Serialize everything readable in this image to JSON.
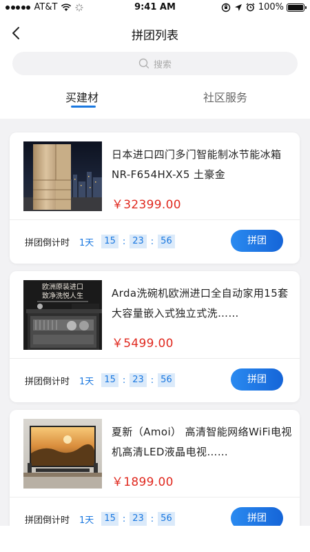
{
  "status_bar": {
    "carrier": "AT&T",
    "time": "9:41 AM",
    "battery": "100%"
  },
  "nav": {
    "title": "拼团列表"
  },
  "search": {
    "placeholder": "搜索"
  },
  "tabs": [
    {
      "label": "买建材",
      "active": true
    },
    {
      "label": "社区服务",
      "active": false
    }
  ],
  "products": [
    {
      "name": "日本进口四门多门智能制冰节能冰箱NR-F654HX-X5 土豪金",
      "price": "￥32399.00",
      "countdown_label": "拼团倒计时",
      "days": "1天",
      "hours": "15",
      "minutes": "23",
      "seconds": "56",
      "button": "拼团",
      "image_icon": "fridge-image"
    },
    {
      "name": "Arda洗碗机欧洲进口全自动家用15套大容量嵌入式独立式洗……",
      "price": "￥5499.00",
      "countdown_label": "拼团倒计时",
      "days": "1天",
      "hours": "15",
      "minutes": "23",
      "seconds": "56",
      "button": "拼团",
      "image_text_1": "欧洲原装进口",
      "image_text_2": "致净洗悦人生",
      "image_icon": "dishwasher-image"
    },
    {
      "name": "夏新（Amoi） 高清智能网络WiFi电视机高清LED液晶电视……",
      "price": "￥1899.00",
      "countdown_label": "拼团倒计时",
      "days": "1天",
      "hours": "15",
      "minutes": "23",
      "seconds": "56",
      "button": "拼团",
      "image_icon": "tv-image"
    }
  ],
  "colors": {
    "accent": "#1a78e0",
    "price": "#e0291f",
    "page_background": "#f2f2f4"
  }
}
